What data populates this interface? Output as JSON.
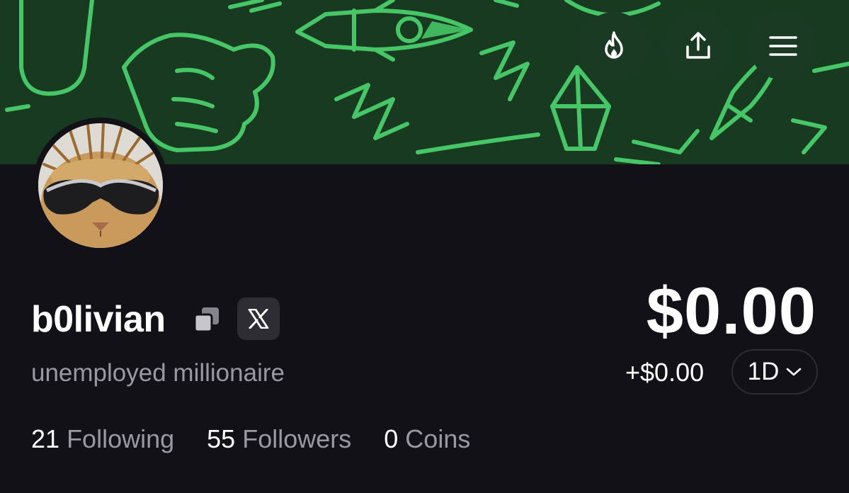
{
  "header": {
    "icons": [
      "flame-icon",
      "share-icon",
      "menu-icon"
    ]
  },
  "profile": {
    "username": "b0livian",
    "bio": "unemployed millionaire",
    "stats": [
      {
        "count": "21",
        "label": "Following"
      },
      {
        "count": "55",
        "label": "Followers"
      },
      {
        "count": "0",
        "label": "Coins"
      }
    ]
  },
  "portfolio": {
    "balance": "$0.00",
    "change": "+$0.00",
    "period": "1D"
  },
  "colors": {
    "banner_bg": "#183a21",
    "banner_pattern": "#46c667",
    "page_bg": "#121117",
    "muted_text": "#9a99a2"
  }
}
